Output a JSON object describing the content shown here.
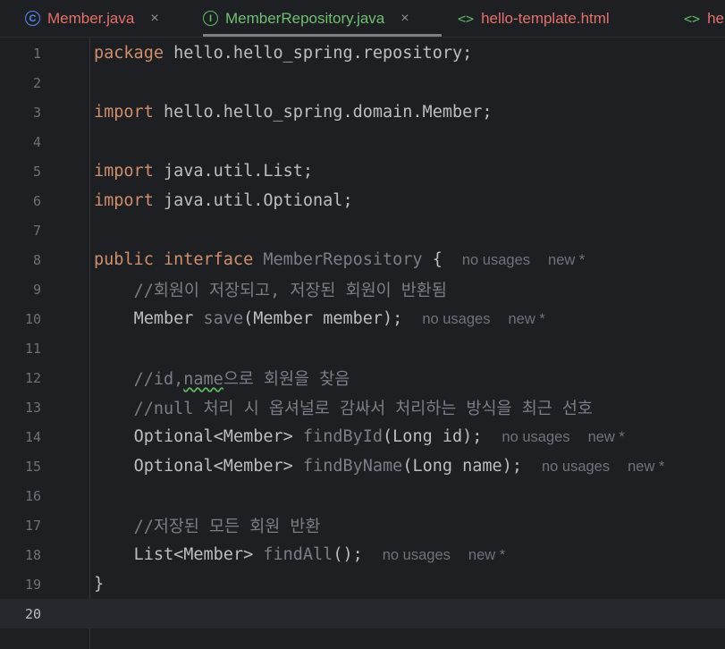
{
  "tabs": [
    {
      "icon": "C",
      "icon_name": "class-icon",
      "label": "Member.java",
      "close": "×",
      "active": false
    },
    {
      "icon": "I",
      "icon_name": "interface-icon",
      "label": "MemberRepository.java",
      "close": "×",
      "active": true
    },
    {
      "icon": "<>",
      "icon_name": "html-icon",
      "label": "hello-template.html",
      "active": false
    },
    {
      "icon": "<>",
      "icon_name": "html-icon",
      "label": "he",
      "active": false
    }
  ],
  "lines": [
    {
      "n": "1"
    },
    {
      "n": "2"
    },
    {
      "n": "3"
    },
    {
      "n": "4"
    },
    {
      "n": "5"
    },
    {
      "n": "6"
    },
    {
      "n": "7"
    },
    {
      "n": "8"
    },
    {
      "n": "9"
    },
    {
      "n": "10"
    },
    {
      "n": "11"
    },
    {
      "n": "12"
    },
    {
      "n": "13"
    },
    {
      "n": "14"
    },
    {
      "n": "15"
    },
    {
      "n": "16"
    },
    {
      "n": "17"
    },
    {
      "n": "18"
    },
    {
      "n": "19"
    },
    {
      "n": "20"
    }
  ],
  "code": {
    "kw_package": "package",
    "l1_rest": " hello.hello_spring.repository;",
    "kw_import": "import",
    "l3_rest": " hello.hello_spring.domain.Member;",
    "l5_rest": " java.util.List;",
    "l6_rest": " java.util.Optional;",
    "kw_public": "public",
    "kw_interface": "interface",
    "l8_name": "MemberRepository",
    "l8_brace": " {",
    "l9_comment": "//회원이 저장되고, 저장된 회원이 반환됨",
    "l10_type": "Member ",
    "l10_method": "save",
    "l10_rest": "(Member member);",
    "l12_comment_a": "//id,",
    "l12_comment_b": "name",
    "l12_comment_c": "으로 회원을 찾음",
    "l13_comment": "//null 처리 시 옵셔널로 감싸서 처리하는 방식을 최근 선호",
    "l14_type": "Optional<Member> ",
    "l14_method": "findById",
    "l14_rest": "(Long id);",
    "l15_type": "Optional<Member> ",
    "l15_method": "findByName",
    "l15_rest": "(Long name);",
    "l17_comment": "//저장된 모든 회원 반환",
    "l18_type": "List<Member> ",
    "l18_method": "findAll",
    "l18_rest": "();",
    "l19_brace": "}"
  },
  "hints": {
    "usages": "no usages",
    "new": "new *"
  },
  "colors": {
    "background": "#1e1f22",
    "keyword": "#cf8e6d",
    "text": "#bcbec4",
    "comment": "#7a7e85",
    "tab_modified": "#e5706b",
    "tab_active": "#6fbf73"
  }
}
